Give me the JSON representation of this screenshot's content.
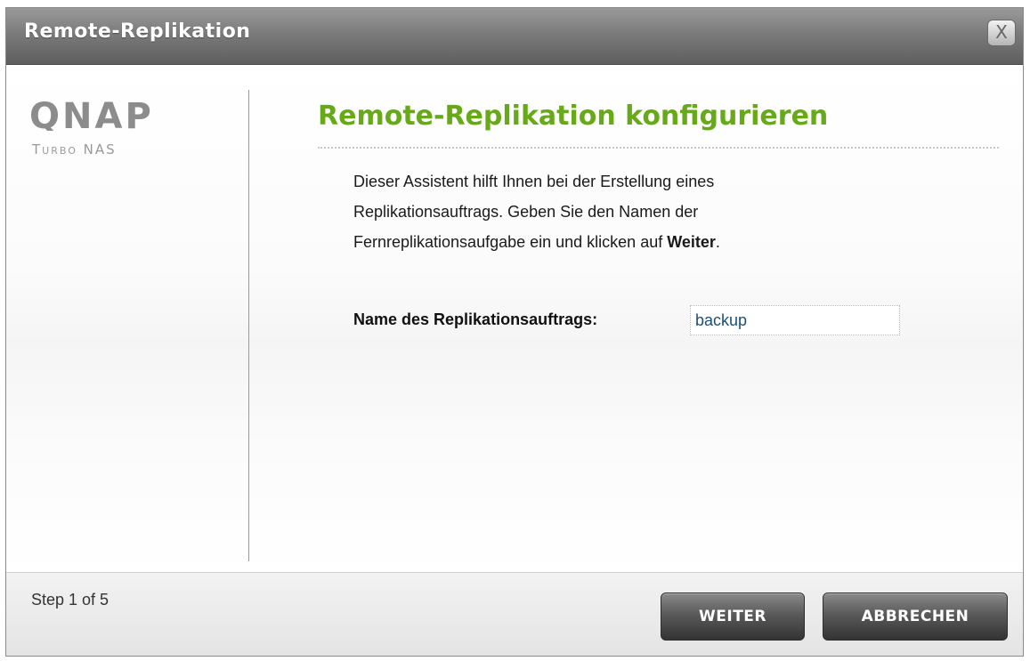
{
  "window": {
    "title": "Remote-Replikation",
    "close_label": "X"
  },
  "brand": {
    "logo_text": "QNAP",
    "subtitle": "Turbo NAS"
  },
  "content": {
    "heading": "Remote-Replikation konfigurieren",
    "description_line1": "Dieser Assistent hilft Ihnen bei der Erstellung eines",
    "description_line2": "Replikationsauftrags.  Geben Sie den Namen der",
    "description_line3_prefix": "Fernreplikationsaufgabe ein und klicken auf ",
    "description_line3_bold": "Weiter",
    "description_line3_suffix": ".",
    "field_label": "Name des Replikationsauftrags:",
    "field_value": "backup"
  },
  "footer": {
    "step_text": "Step 1 of 5",
    "next_label": "WEITER",
    "cancel_label": "ABBRECHEN"
  },
  "colors": {
    "accent_green": "#67a919",
    "titlebar": "#7b7b7b",
    "button_dark": "#4a4a4a",
    "logo_gray": "#8c8c8c"
  }
}
